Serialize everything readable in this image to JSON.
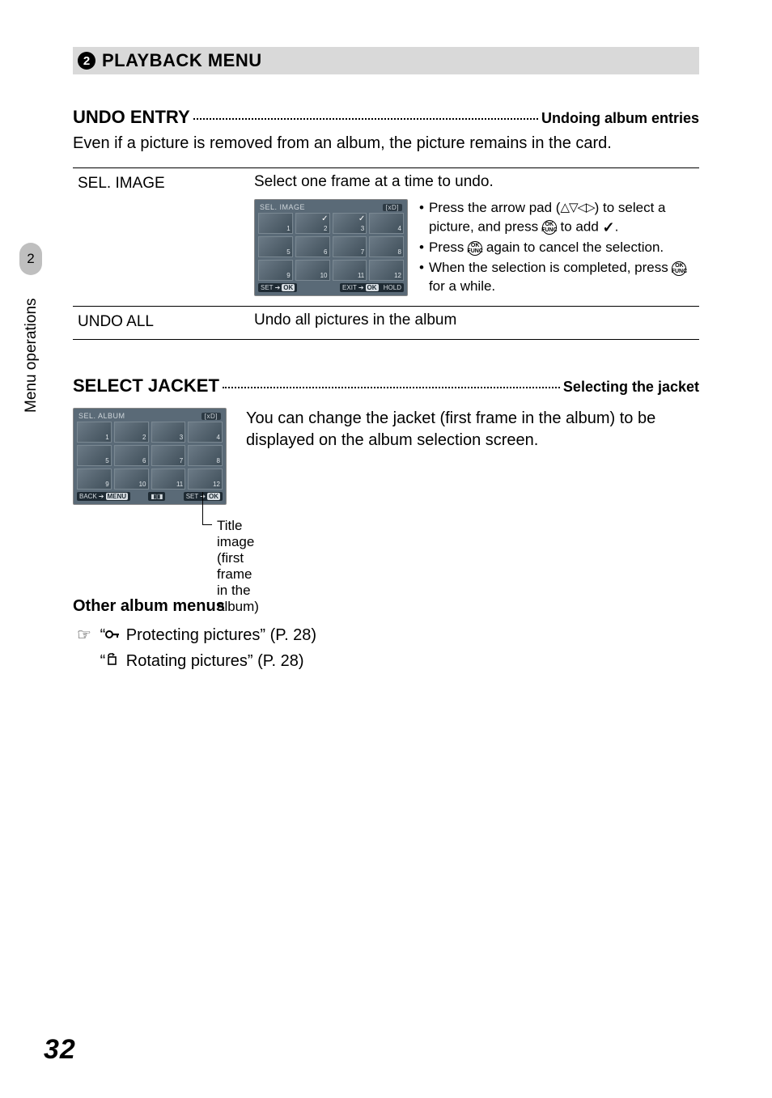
{
  "sidebar": {
    "chapter_num": "2",
    "chapter_label": "Menu operations"
  },
  "section": {
    "number": "2",
    "title": "PLAYBACK MENU"
  },
  "undo": {
    "heading_left": "UNDO ENTRY",
    "heading_right": "Undoing album entries",
    "intro": "Even if a picture is removed from an album, the picture remains in the card.",
    "opt1": {
      "label": "SEL. IMAGE",
      "desc": "Select one frame at a time to undo.",
      "bullet1_a": "Press the arrow pad (",
      "bullet1_b": ") to select a picture, and press ",
      "bullet1_c": " to add ",
      "bullet1_d": ".",
      "bullet2_a": "Press ",
      "bullet2_b": " again to cancel the selection.",
      "bullet3_a": "When the selection is completed, press ",
      "bullet3_b": " for a while."
    },
    "opt2": {
      "label": "UNDO ALL",
      "desc": "Undo all pictures in the album"
    },
    "preview1": {
      "title": "SEL. IMAGE",
      "tag": "[xD]",
      "cells": [
        "1",
        "2",
        "3",
        "4",
        "5",
        "6",
        "7",
        "8",
        "9",
        "10",
        "11",
        "12"
      ],
      "checks": [
        1,
        2
      ],
      "ftr_left_a": "SET",
      "ftr_left_b": "OK",
      "ftr_right_a": "EXIT",
      "ftr_right_b": "OK",
      "ftr_right_c": "HOLD"
    }
  },
  "jacket": {
    "heading_left": "SELECT JACKET",
    "heading_right": "Selecting the jacket",
    "body": "You can change the jacket (first frame in the album) to be displayed on the album selection screen.",
    "caption": "Title image (first frame in the album)",
    "preview": {
      "title": "SEL. ALBUM",
      "tag": "[xD]",
      "cells": [
        "1",
        "2",
        "3",
        "4",
        "5",
        "6",
        "7",
        "8",
        "9",
        "10",
        "11",
        "12"
      ],
      "ftr_left_a": "BACK",
      "ftr_left_b": "MENU",
      "ftr_right_a": "SET",
      "ftr_right_b": "OK"
    }
  },
  "other": {
    "heading": "Other album menus",
    "line1_a": "“",
    "line1_b": " Protecting pictures” (P. 28)",
    "line2_a": "“",
    "line2_b": " Rotating pictures” (P. 28)"
  },
  "icons": {
    "arrows": "△▽◁▷",
    "ok_top": "OK",
    "ok_bot": "FUNC",
    "check": "✓",
    "hand": "☞",
    "key": "O–π",
    "rotate": "↻"
  },
  "page_number": "32"
}
